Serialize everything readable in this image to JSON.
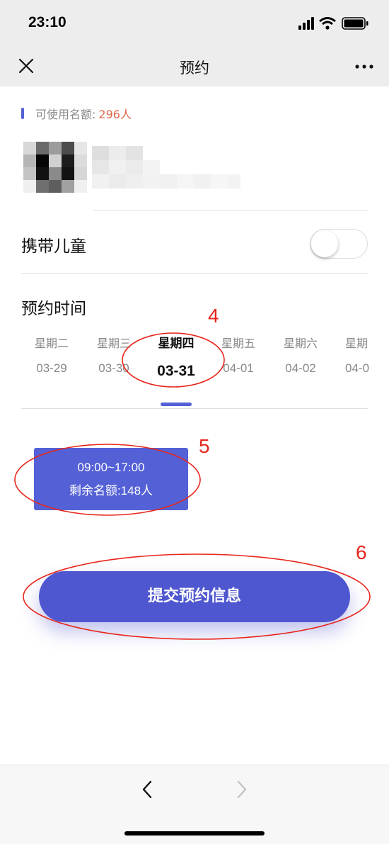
{
  "status_bar": {
    "time": "23:10"
  },
  "nav": {
    "title": "预约"
  },
  "quota": {
    "label": "可使用名额:",
    "value": "296人"
  },
  "child": {
    "label": "携带儿童",
    "enabled": false
  },
  "schedule": {
    "title": "预约时间",
    "dates": [
      {
        "weekday": "星期二",
        "date": "03-29"
      },
      {
        "weekday": "星期三",
        "date": "03-30"
      },
      {
        "weekday": "星期四",
        "date": "03-31"
      },
      {
        "weekday": "星期五",
        "date": "04-01"
      },
      {
        "weekday": "星期六",
        "date": "04-02"
      },
      {
        "weekday": "星期",
        "date": "04-0"
      }
    ],
    "selected_index": 2
  },
  "slot": {
    "time": "09:00~17:00",
    "remaining": "剩余名额:148人"
  },
  "submit": {
    "label": "提交预约信息"
  },
  "annotations": [
    "4",
    "5",
    "6"
  ],
  "colors": {
    "accent": "#5461d6",
    "quota_value": "#e0674c",
    "annotation": "#e8261c"
  }
}
